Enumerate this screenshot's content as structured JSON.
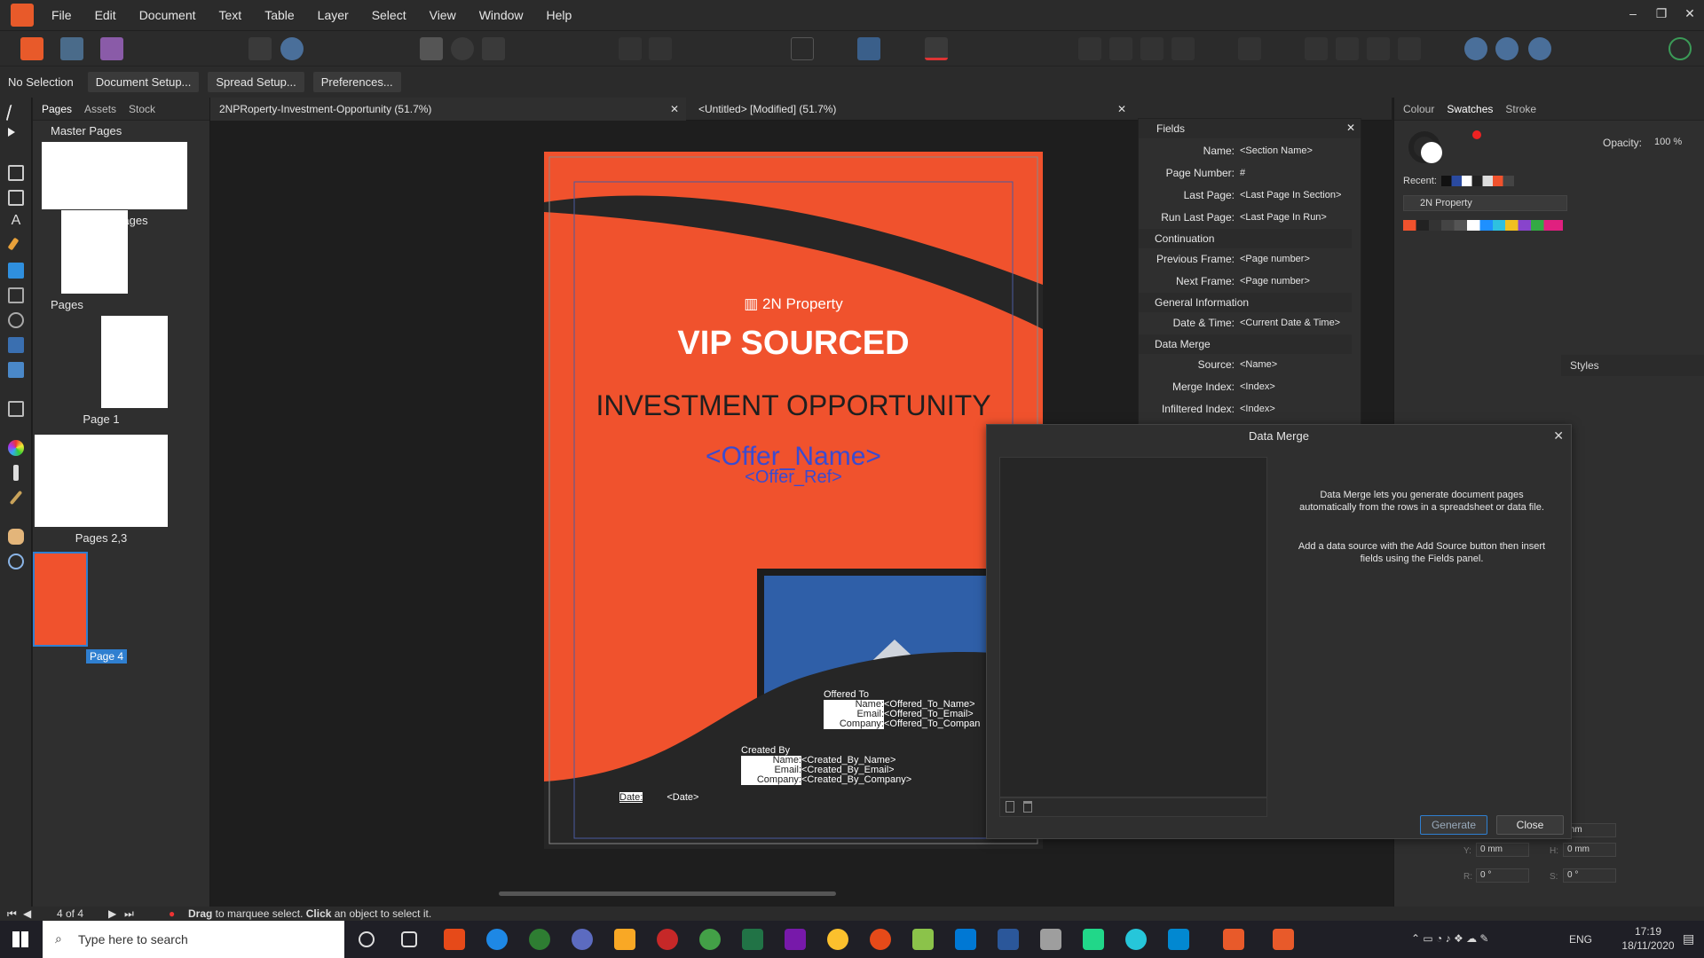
{
  "menubar": {
    "items": [
      "File",
      "Edit",
      "Document",
      "Text",
      "Table",
      "Layer",
      "Select",
      "View",
      "Window",
      "Help"
    ],
    "window_controls": [
      "–",
      "❐",
      "✕"
    ]
  },
  "contextbar": {
    "selection_label": "No Selection",
    "buttons": [
      "Document Setup...",
      "Spread Setup...",
      "Preferences..."
    ]
  },
  "pages_panel": {
    "tabs": [
      "Pages",
      "Assets",
      "Stock"
    ],
    "master_pages_label": "Master Pages",
    "masters": [
      "Inside Pages",
      ""
    ],
    "pages_label": "Pages",
    "pages": [
      "Page 1",
      "Pages 2,3",
      "Page 4"
    ]
  },
  "doc_tabs": [
    "2NPRoperty-Investment-Opportunity (51.7%)",
    "<Untitled> [Modified] (51.7%)"
  ],
  "document": {
    "brand": "2N Property",
    "heading1": "VIP SOURCED",
    "heading2": "INVESTMENT OPPORTUNITY",
    "offer_name": "<Offer_Name>",
    "offer_ref": "<Offer_Ref>",
    "offered_to": {
      "title": "Offered To",
      "rows": [
        [
          "Name:",
          "<Offered_To_Name>"
        ],
        [
          "Email:",
          "<Offered_To_Email>"
        ],
        [
          "Company:",
          "<Offered_To_Compan"
        ]
      ]
    },
    "created_by": {
      "title": "Created By",
      "rows": [
        [
          "Name:",
          "<Created_By_Name>"
        ],
        [
          "Email:",
          "<Created_By_Email>"
        ],
        [
          "Company:",
          "<Created_By_Company>"
        ]
      ]
    },
    "date_label": "Date:",
    "date_value": "<Date>",
    "colors": {
      "orange": "#f0522d",
      "dark": "#262626"
    }
  },
  "fields_panel": {
    "title": "Fields",
    "rows": [
      {
        "label": "Name:",
        "value": "<Section Name>"
      },
      {
        "label": "Page Number:",
        "value": "#"
      },
      {
        "label": "Last Page:",
        "value": "<Last Page In Section>"
      },
      {
        "label": "Run Last Page:",
        "value": "<Last Page In Run>"
      }
    ],
    "group_continuation": "Continuation",
    "continuation_rows": [
      {
        "label": "Previous Frame:",
        "value": "<Page number>"
      },
      {
        "label": "Next Frame:",
        "value": "<Page number>"
      }
    ],
    "group_general": "General Information",
    "general_rows": [
      {
        "label": "Date & Time:",
        "value": "<Current Date & Time>"
      }
    ],
    "group_merge": "Data Merge",
    "merge_rows": [
      {
        "label": "Source:",
        "value": "<Name>"
      },
      {
        "label": "Merge Index:",
        "value": "<Index>"
      },
      {
        "label": "Infiltered Index:",
        "value": "<Index>"
      }
    ]
  },
  "right_panel": {
    "tabs": [
      "Colour",
      "Swatches",
      "Stroke"
    ],
    "opacity_label": "Opacity:",
    "opacity_value": "100 %",
    "recent_label": "Recent:",
    "palette_name": "2N Property",
    "styles_tab": "Styles",
    "transform_values": [
      "mm",
      "0 mm",
      "0 mm",
      "0 °",
      "0 °"
    ],
    "transform_labels": [
      "Y:",
      "H:",
      "R:",
      "S:"
    ]
  },
  "data_merge": {
    "title": "Data Merge",
    "description1": "Data Merge lets you generate document pages automatically from the rows in a spreadsheet or data file.",
    "description2": "Add a data source with the Add Source button then insert fields using the Fields panel.",
    "generate_label": "Generate",
    "close_label": "Close"
  },
  "statusbar": {
    "page_counter": "4 of 4",
    "hint_drag": "Drag",
    "hint_mid": " to marquee select. ",
    "hint_click": "Click",
    "hint_end": " an object to select it."
  },
  "taskbar": {
    "search_placeholder": "Type here to search",
    "language": "ENG",
    "time": "17:19",
    "date": "18/11/2020"
  }
}
